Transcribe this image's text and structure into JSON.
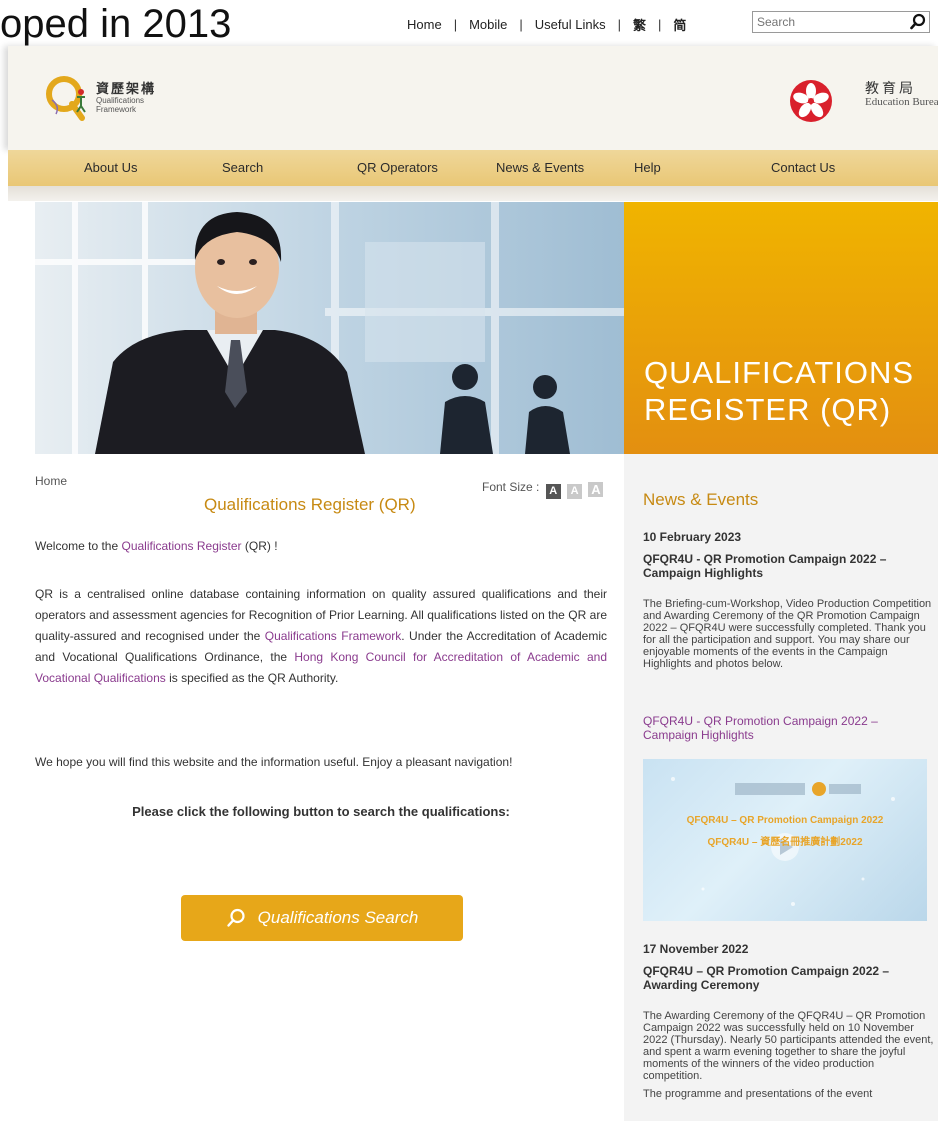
{
  "caption": "oped in 2013",
  "top_nav": {
    "home": "Home",
    "mobile": "Mobile",
    "useful_links": "Useful Links",
    "trad_chinese": "繁",
    "simp_chinese": "简",
    "search_placeholder": "Search"
  },
  "header": {
    "qf_logo_cn": "資歷架構",
    "qf_logo_en_1": "Qualifications",
    "qf_logo_en_2": "Framework",
    "edb_cn": "教育局",
    "edb_en": "Education Bureau"
  },
  "main_nav": {
    "items": [
      "About Us",
      "Search",
      "QR Operators",
      "News & Events",
      "Help",
      "Contact Us"
    ]
  },
  "hero": {
    "title_line1": "QUALIFICATIONS",
    "title_line2": "REGISTER (QR)"
  },
  "breadcrumb": {
    "home": "Home"
  },
  "font_size": {
    "label": "Font Size :",
    "small": "A",
    "medium": "A",
    "large": "A"
  },
  "content": {
    "title": "Qualifications Register (QR)",
    "welcome_before": "Welcome to the ",
    "welcome_link": "Qualifications Register",
    "welcome_after": " (QR) !",
    "p2_a": "QR is a centralised online database containing information on quality assured qualifications and their operators and assessment agencies for Recognition of Prior Learning. All qualifications listed on the QR are quality-assured and recognised under the ",
    "p2_link1": "Qualifications Framework",
    "p2_b": ". Under the Accreditation of Academic and Vocational Qualifications Ordinance, the ",
    "p2_link2": "Hong Kong Council for Accreditation of Academic and Vocational Qualifications",
    "p2_c": " is specified as the QR Authority.",
    "p3": "We hope you will find this website and the information useful. Enjoy a pleasant navigation!",
    "cta": "Please click the following button to search the qualifications:",
    "search_button": "Qualifications Search"
  },
  "sidebar": {
    "title": "News & Events",
    "news": [
      {
        "date": "10 February 2023",
        "headline": "QFQR4U - QR Promotion Campaign 2022 – Campaign Highlights",
        "text": "The Briefing-cum-Workshop, Video Production Competition and Awarding Ceremony of the QR Promotion Campaign 2022 – QFQR4U were successfully completed. Thank you for all the participation and support. You may share our enjoyable moments of the events in the Campaign Highlights and photos below.",
        "link": "QFQR4U - QR Promotion Campaign 2022 – Campaign Highlights"
      },
      {
        "date": "17 November 2022",
        "headline": "QFQR4U – QR Promotion Campaign 2022 – Awarding Ceremony",
        "text": "The Awarding Ceremony of the QFQR4U – QR Promotion Campaign 2022 was successfully held on 10 November 2022 (Thursday). Nearly 50 participants attended the event, and spent a warm evening together to share the joyful moments of the winners of the video production competition.",
        "text2": "The programme and presentations of the event"
      }
    ],
    "video_text_1": "QFQR4U – QR Promotion Campaign 2022",
    "video_text_2": "QFQR4U – 資歷名冊推廣計劃2022"
  },
  "colors": {
    "accent_gold": "#c78a13",
    "nav_bar": "#ecd089",
    "hero_orange": "#e9a30c",
    "link_purple": "#8a3b8e",
    "button_gold": "#e7a719"
  }
}
